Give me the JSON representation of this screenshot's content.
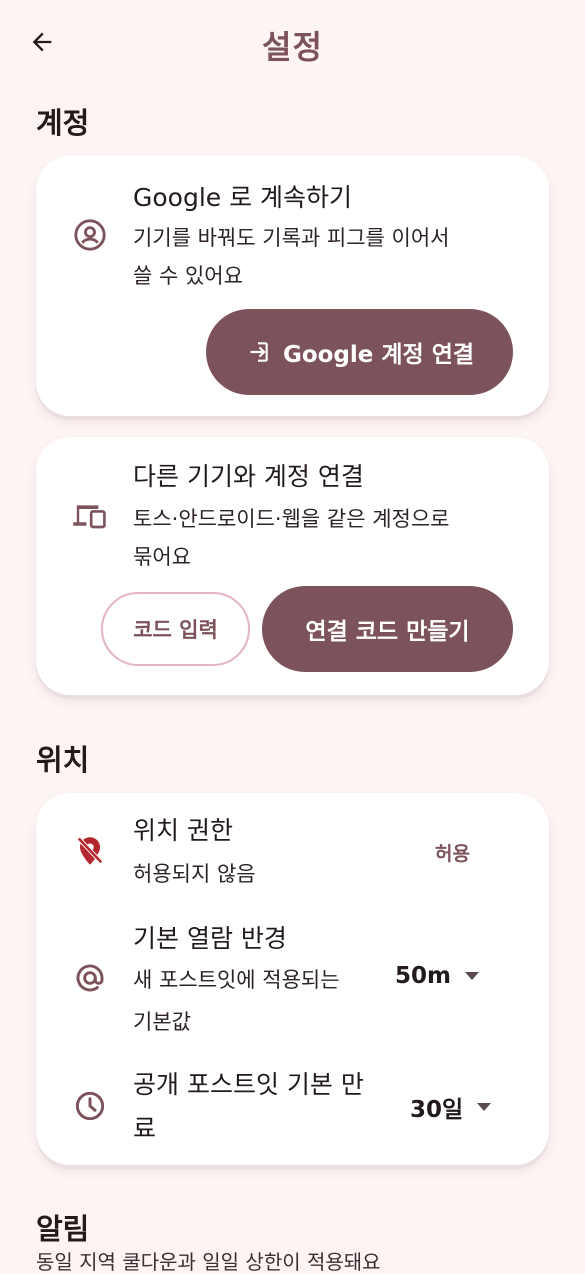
{
  "header": {
    "title": "설정",
    "back_icon": "arrow-left-icon"
  },
  "sections": {
    "account": {
      "title": "계정",
      "google": {
        "icon": "account-circle-icon",
        "title": "Google 로 계속하기",
        "desc_line1": "기기를 바꿔도 기록과 피그를 이어서",
        "desc_line2": "쓸 수 있어요",
        "button_label": "Google 계정 연결",
        "button_icon": "login-icon"
      },
      "link_device": {
        "icon": "devices-icon",
        "title": "다른 기기와 계정 연결",
        "desc_line1": "토스·안드로이드·웹을 같은 계정으로",
        "desc_line2": "묶어요",
        "code_input_label": "코드 입력",
        "create_code_label": "연결 코드 만들기"
      }
    },
    "location": {
      "title": "위치",
      "permission": {
        "icon": "location-off-icon",
        "title": "위치 권한",
        "desc": "허용되지 않음",
        "action_label": "허용"
      },
      "radius": {
        "icon": "at-sign-icon",
        "title": "기본 열람 반경",
        "desc_line1": "새 포스트잇에 적용되는",
        "desc_line2": "기본값",
        "value": "50m"
      },
      "expiry": {
        "icon": "clock-icon",
        "title_line1": "공개 포스트잇 기본 만",
        "title_line2": "료",
        "value": "30일"
      }
    },
    "notifications": {
      "title": "알림",
      "desc_partial": "동일 지역 쿨다운과 일일 상한이 적용돼요"
    }
  },
  "colors": {
    "background": "#fdf4f4",
    "accent": "#7c525b",
    "outline": "#e4b4c0",
    "warning_icon": "#b3262e"
  }
}
